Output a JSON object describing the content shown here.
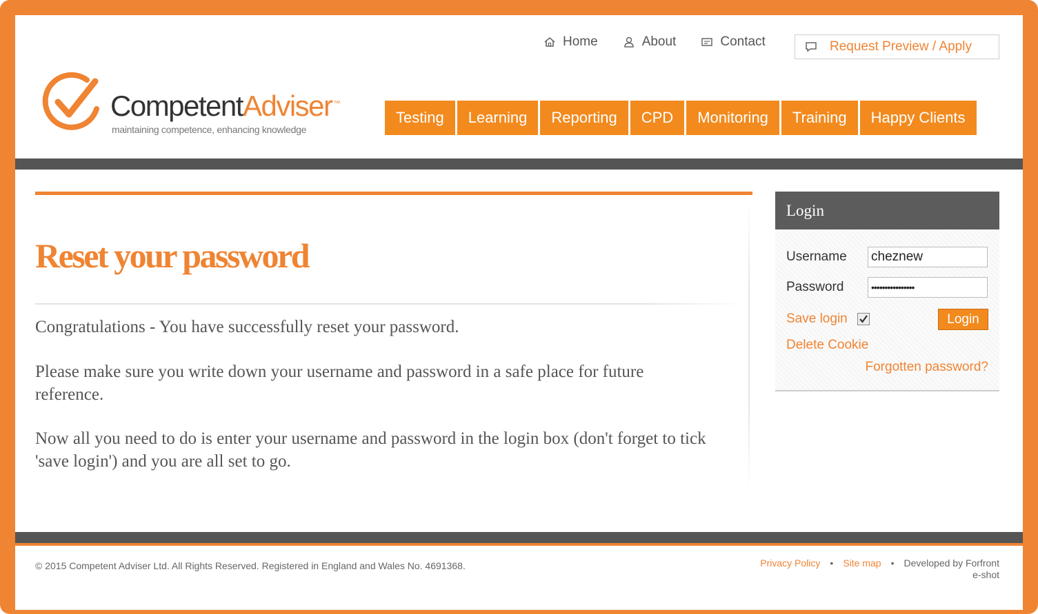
{
  "top_nav": {
    "home": "Home",
    "about": "About",
    "contact": "Contact",
    "request": "Request Preview / Apply"
  },
  "logo": {
    "name_part1": "Competent",
    "name_part2": "Adviser",
    "trademark": "™",
    "tagline": "maintaining competence, enhancing knowledge"
  },
  "main_nav": [
    "Testing",
    "Learning",
    "Reporting",
    "CPD",
    "Monitoring",
    "Training",
    "Happy Clients"
  ],
  "content": {
    "title": "Reset your password",
    "p1": "Congratulations - You have successfully reset your password.",
    "p2": "Please make sure you write down your username and password in a safe place for future reference.",
    "p3": "Now all you need to do is enter your username and password in the login box (don't forget to tick 'save login') and you are all set to go."
  },
  "login": {
    "title": "Login",
    "username_label": "Username",
    "username_value": "cheznew",
    "password_label": "Password",
    "password_value": "••••••••••••••••",
    "save_login": "Save login",
    "save_checked": true,
    "button": "Login",
    "delete_cookie": "Delete Cookie",
    "forgot": "Forgotten password?"
  },
  "footer": {
    "copyright": "© 2015 Competent Adviser Ltd. All Rights Reserved. Registered in England and Wales No. 4691368.",
    "privacy": "Privacy Policy",
    "sitemap": "Site map",
    "separator": "•",
    "developed_line1": "Developed by Forfront",
    "developed_line2": "e-shot"
  },
  "colors": {
    "accent": "#ef8433",
    "nav_orange": "#f28a1e",
    "dark_bar": "#555555"
  }
}
